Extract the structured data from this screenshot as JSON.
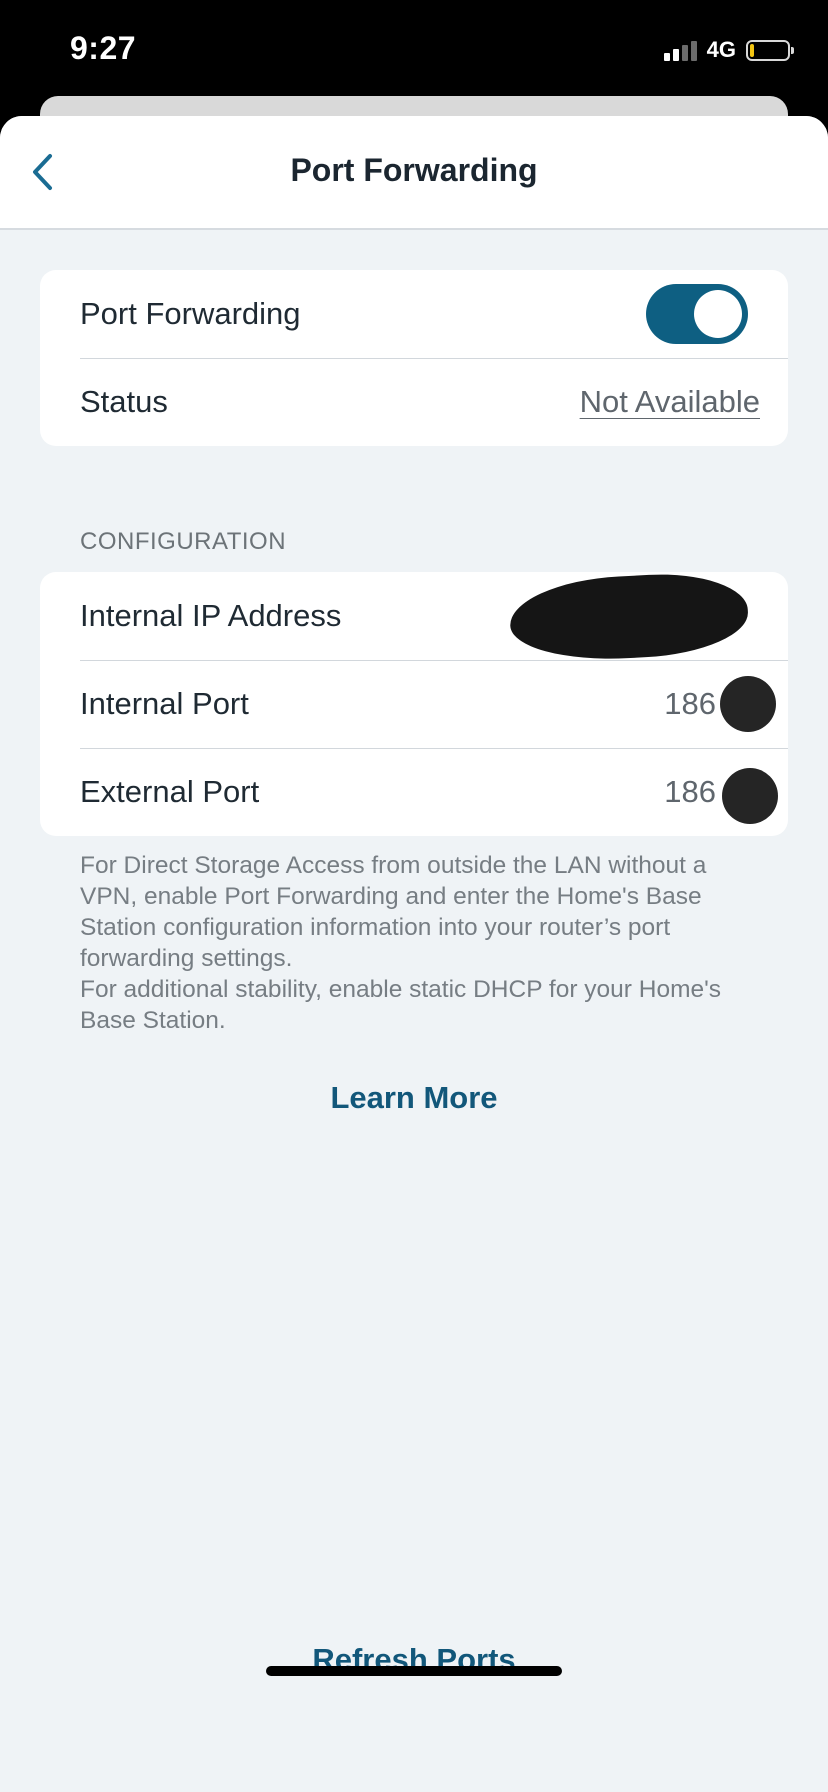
{
  "status_bar": {
    "time": "9:27",
    "network": "4G",
    "signal_bars_filled": 2,
    "signal_bars_total": 4,
    "battery_level": 0.1
  },
  "nav": {
    "back_icon": "chevron-left-icon",
    "title": "Port Forwarding"
  },
  "general": {
    "port_forwarding_label": "Port Forwarding",
    "port_forwarding_enabled": true,
    "status_label": "Status",
    "status_value": "Not Available"
  },
  "configuration": {
    "header": "CONFIGURATION",
    "internal_ip_label": "Internal IP Address",
    "internal_port_label": "Internal Port",
    "internal_port_value": "186",
    "external_port_label": "External Port",
    "external_port_value": "186"
  },
  "footnote": {
    "line1": "For Direct Storage Access from outside the LAN without a VPN, enable Port Forwarding and enter the Home's Base Station configuration information into your router’s port forwarding settings.",
    "line2": "For additional stability, enable static DHCP for your Home's Base Station."
  },
  "actions": {
    "learn_more": "Learn More",
    "refresh_ports": "Refresh Ports"
  },
  "colors": {
    "accent": "#0e5f82",
    "link": "#12577a",
    "background": "#eff3f6"
  }
}
